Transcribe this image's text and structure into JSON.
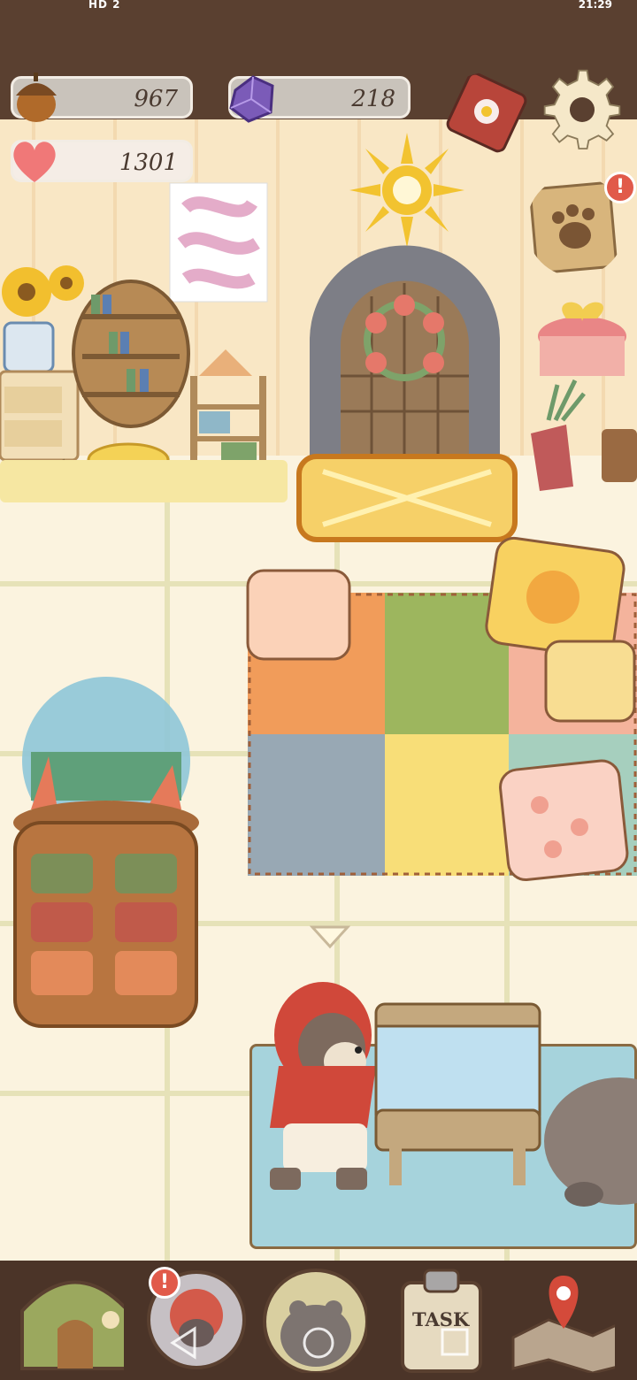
{
  "status_bar": {
    "left": "HD 2",
    "right": "21:29"
  },
  "hud": {
    "acorns": "967",
    "gems": "218",
    "hearts": "1301"
  },
  "bottom_nav": {
    "task_label": "TASK"
  },
  "colors": {
    "brown_dark": "#4b3428",
    "heart_pink": "#f07878",
    "gem_purple": "#7b5bb8",
    "acorn_brown": "#b06a2a",
    "badge_red": "#e15a4a"
  },
  "icons": [
    "acorn-icon",
    "gem-icon",
    "heart-icon",
    "journal-icon",
    "settings-gear-icon",
    "paw-note-icon",
    "home-icon",
    "character-icon",
    "bear-icon",
    "clipboard-icon",
    "map-icon",
    "back-nav-icon",
    "home-nav-icon",
    "recent-nav-icon"
  ]
}
